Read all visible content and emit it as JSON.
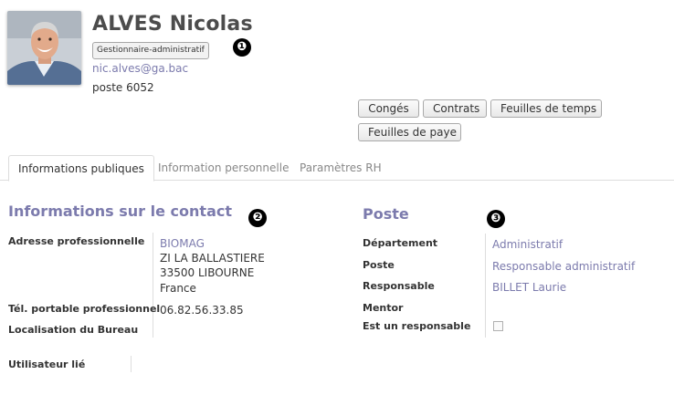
{
  "header": {
    "name": "ALVES Nicolas",
    "job_tag": "Gestionnaire-administratif",
    "email": "nic.alves@ga.bac",
    "phone": "poste 6052",
    "badges": [
      "❶",
      "❷",
      "❸"
    ]
  },
  "actions": {
    "conges": "Congés",
    "contrats": "Contrats",
    "feuilles_temps": "Feuilles de temps",
    "feuilles_paye": "Feuilles de paye"
  },
  "tabs": [
    {
      "label": "Informations publiques",
      "active": true
    },
    {
      "label": "Information personnelle",
      "active": false
    },
    {
      "label": "Paramètres RH",
      "active": false
    }
  ],
  "contact": {
    "title": "Informations sur le contact",
    "address_label": "Adresse professionnelle",
    "address": {
      "company": "BIOMAG",
      "street": "ZI LA BALLASTIERE",
      "city": "33500 LIBOURNE",
      "country": "France"
    },
    "mobile_label": "Tél. portable professionnel",
    "mobile_value": "06.82.56.33.85",
    "office_label": "Localisation du Bureau",
    "office_value": ""
  },
  "poste": {
    "title": "Poste",
    "department_label": "Département",
    "department_value": "Administratif",
    "job_label": "Poste",
    "job_value": "Responsable administratif",
    "manager_label": "Responsable",
    "manager_value": "BILLET Laurie",
    "mentor_label": "Mentor",
    "mentor_value": "",
    "is_manager_label": "Est un responsable",
    "is_manager_value": false
  },
  "user": {
    "label": "Utilisateur lié",
    "value": ""
  },
  "colors": {
    "accent": "#7c7bad",
    "text": "#333333",
    "border": "#dddddd"
  }
}
